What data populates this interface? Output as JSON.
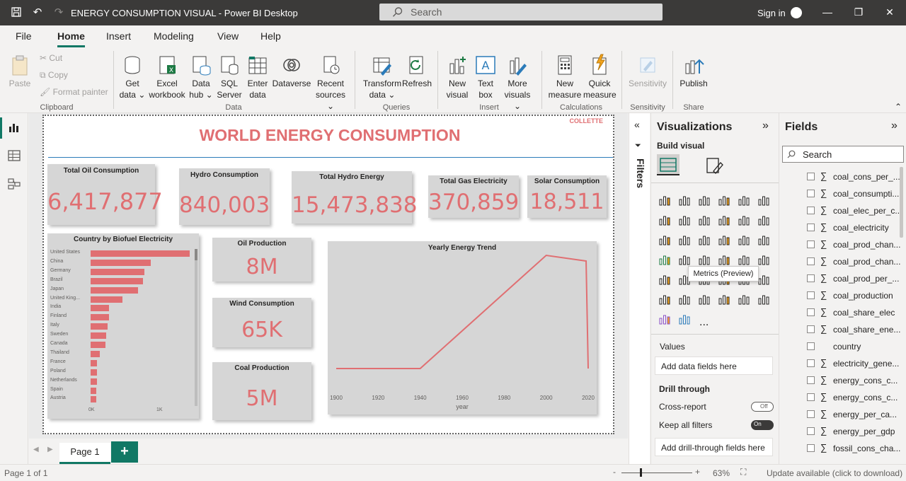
{
  "window": {
    "title": "ENERGY CONSUMPTION VISUAL - Power BI Desktop",
    "search_placeholder": "Search",
    "sign_in": "Sign in"
  },
  "menu": [
    "File",
    "Home",
    "Insert",
    "Modeling",
    "View",
    "Help"
  ],
  "ribbon": {
    "clipboard": {
      "paste": "Paste",
      "cut": "Cut",
      "copy": "Copy",
      "format_painter": "Format painter",
      "group": "Clipboard"
    },
    "data": {
      "get_data": "Get data",
      "excel": "Excel workbook",
      "data_hub": "Data hub",
      "sql": "SQL Server",
      "enter_data": "Enter data",
      "dataverse": "Dataverse",
      "recent": "Recent sources",
      "group": "Data"
    },
    "queries": {
      "transform": "Transform data",
      "refresh": "Refresh",
      "group": "Queries"
    },
    "insert": {
      "new_visual": "New visual",
      "text_box": "Text box",
      "more_visuals": "More visuals",
      "group": "Insert"
    },
    "calculations": {
      "new_measure": "New measure",
      "quick_measure": "Quick measure",
      "group": "Calculations"
    },
    "sensitivity": {
      "label": "Sensitivity",
      "group": "Sensitivity"
    },
    "share": {
      "publish": "Publish",
      "group": "Share"
    }
  },
  "report": {
    "title": "WORLD ENERGY CONSUMPTION",
    "author": "COLLETTE",
    "cards": [
      {
        "label": "Total Oil Consumption",
        "value": "6,417,877"
      },
      {
        "label": "Hydro Consumption",
        "value": "840,003"
      },
      {
        "label": "Total Hydro Energy",
        "value": "15,473,838"
      },
      {
        "label": "Total Gas Electricity",
        "value": "370,859"
      },
      {
        "label": "Solar Consumption",
        "value": "18,511"
      },
      {
        "label": "Oil Production",
        "value": "8M"
      },
      {
        "label": "Wind Consumption",
        "value": "65K"
      },
      {
        "label": "Coal Production",
        "value": "5M"
      }
    ]
  },
  "chart_data": [
    {
      "type": "bar",
      "title": "Country by Biofuel Electricity",
      "orientation": "horizontal",
      "categories": [
        "United States",
        "China",
        "Germany",
        "Brazil",
        "Japan",
        "United King...",
        "India",
        "Finland",
        "Italy",
        "Sweden",
        "Canada",
        "Thailand",
        "France",
        "Poland",
        "Netherlands",
        "Spain",
        "Austria"
      ],
      "values": [
        1200,
        730,
        650,
        640,
        580,
        390,
        220,
        220,
        210,
        190,
        180,
        110,
        80,
        80,
        75,
        70,
        70
      ],
      "xticks": [
        "0K",
        "1K"
      ],
      "xlim": [
        0,
        1300
      ]
    },
    {
      "type": "line",
      "title": "Yearly Energy Trend",
      "xlabel": "year",
      "x": [
        1900,
        1940,
        2000,
        2019,
        2020
      ],
      "values": [
        0.0,
        0.0,
        1.0,
        0.95,
        0.0
      ],
      "xticks": [
        1900,
        1920,
        1940,
        1960,
        1980,
        2000,
        2020
      ],
      "xlim": [
        1900,
        2020
      ],
      "color": "#e06f72"
    }
  ],
  "pages": {
    "current": "Page 1",
    "add": "+"
  },
  "filters": {
    "label": "Filters"
  },
  "visualizations": {
    "title": "Visualizations",
    "build_visual": "Build visual",
    "tooltip": "Metrics (Preview)",
    "values_label": "Values",
    "add_data_fields": "Add data fields here",
    "drill_through": "Drill through",
    "cross_report": "Cross-report",
    "cross_report_state": "Off",
    "keep_all_filters": "Keep all filters",
    "keep_all_filters_state": "On",
    "add_drill_fields": "Add drill-through fields here",
    "more": "..."
  },
  "fields": {
    "title": "Fields",
    "search_placeholder": "Search",
    "items": [
      {
        "name": "coal_cons_per_...",
        "sigma": true
      },
      {
        "name": "coal_consumpti...",
        "sigma": true
      },
      {
        "name": "coal_elec_per_c...",
        "sigma": true
      },
      {
        "name": "coal_electricity",
        "sigma": true
      },
      {
        "name": "coal_prod_chan...",
        "sigma": true
      },
      {
        "name": "coal_prod_chan...",
        "sigma": true
      },
      {
        "name": "coal_prod_per_...",
        "sigma": true
      },
      {
        "name": "coal_production",
        "sigma": true
      },
      {
        "name": "coal_share_elec",
        "sigma": true
      },
      {
        "name": "coal_share_ene...",
        "sigma": true
      },
      {
        "name": "country",
        "sigma": false
      },
      {
        "name": "electricity_gene...",
        "sigma": true
      },
      {
        "name": "energy_cons_c...",
        "sigma": true
      },
      {
        "name": "energy_cons_c...",
        "sigma": true
      },
      {
        "name": "energy_per_ca...",
        "sigma": true
      },
      {
        "name": "energy_per_gdp",
        "sigma": true
      },
      {
        "name": "fossil_cons_cha...",
        "sigma": true
      }
    ]
  },
  "status": {
    "page": "Page 1 of 1",
    "zoom": "63%",
    "update": "Update available (click to download)"
  }
}
